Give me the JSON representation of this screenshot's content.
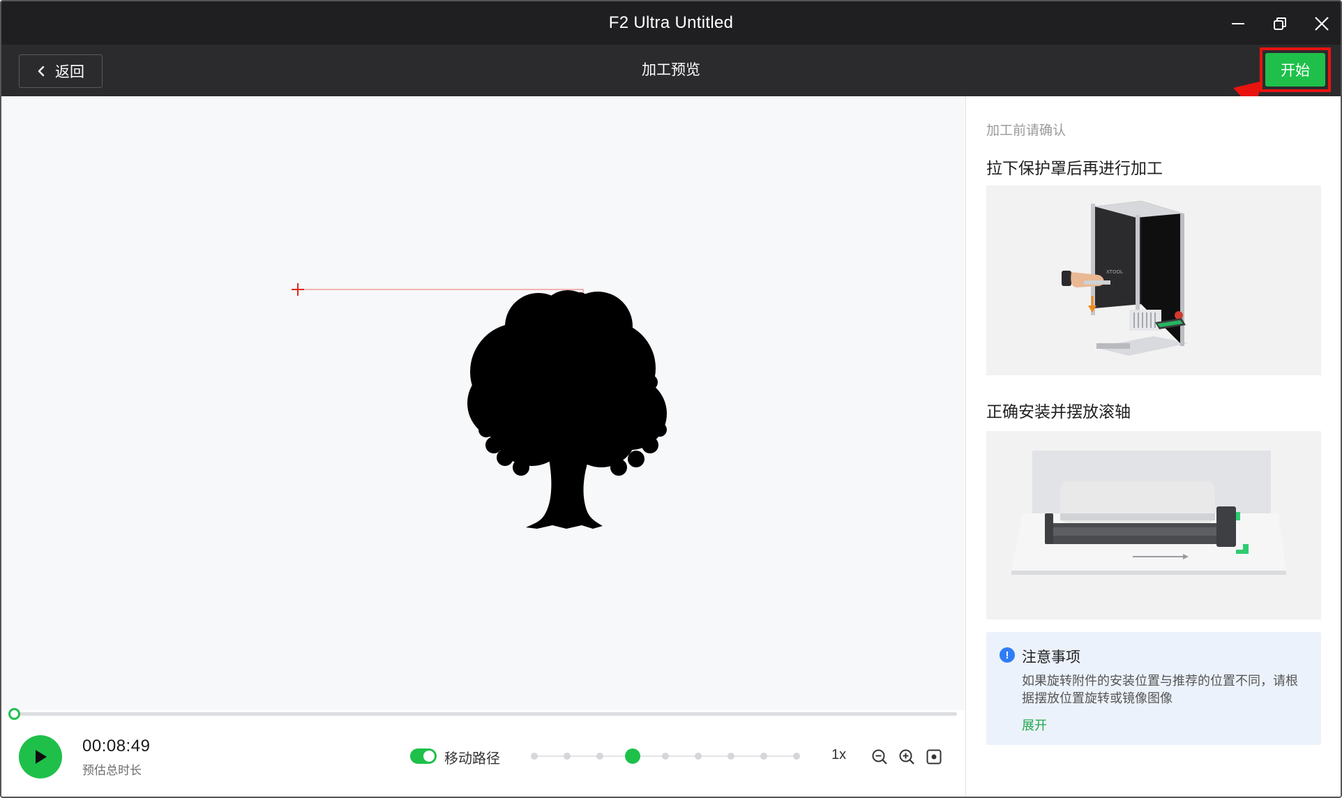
{
  "window": {
    "title": "F2 Ultra Untitled",
    "controls": [
      "minimize-icon",
      "restore-icon",
      "close-icon"
    ]
  },
  "toolbar": {
    "back_label": "返回",
    "page_title": "加工预览",
    "start_label": "开始"
  },
  "preview": {
    "origin_marker": "crosshair-icon",
    "shape": "tree-silhouette"
  },
  "playback": {
    "progress": 0,
    "time_value": "00:08:49",
    "time_label": "预估总时长",
    "path_toggle_label": "移动路径",
    "path_toggle_on": true,
    "speed_steps": 9,
    "speed_selected_index": 3,
    "speed_value": "1x",
    "zoom_icons": [
      "zoom-out-icon",
      "zoom-in-icon",
      "fit-view-icon"
    ]
  },
  "side_panel": {
    "confirm_hint": "加工前请确认",
    "step1_title": "拉下保护罩后再进行加工",
    "step2_title": "正确安装并摆放滚轴",
    "notice": {
      "title": "注意事项",
      "icon": "info-icon",
      "body": "如果旋转附件的安装位置与推荐的位置不同，请根据摆放位置旋转或镜像图像",
      "expand_label": "展开"
    }
  },
  "colors": {
    "accent_green": "#1ec04a",
    "titlebar_bg": "#1f1f21",
    "toolbar_bg": "#2b2b2e",
    "annotation_red": "#e8130f",
    "notice_bg": "#ecf2fb",
    "info_blue": "#2f7df6"
  }
}
